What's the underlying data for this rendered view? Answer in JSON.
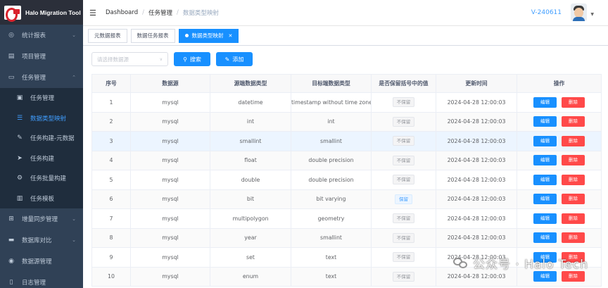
{
  "app": {
    "title": "Halo Migration Tool"
  },
  "sidebar": {
    "items": [
      {
        "label": "统计报表",
        "icon": "dashboard-icon"
      },
      {
        "label": "项目管理",
        "icon": "database-icon"
      },
      {
        "label": "任务管理",
        "icon": "monitor-icon",
        "expanded": true
      }
    ],
    "submenu": [
      {
        "label": "任务管理",
        "icon": "clipboard-icon"
      },
      {
        "label": "数据类型映射",
        "icon": "list-icon",
        "active": true
      },
      {
        "label": "任务构建-元数据",
        "icon": "edit-icon"
      },
      {
        "label": "任务构建",
        "icon": "send-icon"
      },
      {
        "label": "任务批量构建",
        "icon": "gear-icon"
      },
      {
        "label": "任务模板",
        "icon": "server-icon"
      }
    ],
    "items2": [
      {
        "label": "增量同步管理",
        "icon": "sitemap-icon"
      },
      {
        "label": "数据库对比",
        "icon": "folder-icon"
      },
      {
        "label": "数据源管理",
        "icon": "database-icon"
      },
      {
        "label": "日志管理",
        "icon": "document-icon"
      }
    ]
  },
  "navbar": {
    "breadcrumb": [
      "Dashboard",
      "任务管理",
      "数据类型映射"
    ],
    "version": "V-240611"
  },
  "tags": [
    {
      "label": "元数据报表"
    },
    {
      "label": "数据任务报表"
    },
    {
      "label": "数据类型映射",
      "active": true
    }
  ],
  "toolbar": {
    "select_placeholder": "请选择数据源",
    "search_label": "搜索",
    "add_label": "添加"
  },
  "table": {
    "columns": [
      "序号",
      "数据源",
      "源端数据类型",
      "目标端数据类型",
      "是否保留括号中的值",
      "更新时间",
      "操作"
    ],
    "rows": [
      [
        "1",
        "mysql",
        "datetime",
        "timestamp without time zone",
        "不保留",
        "2024-04-28 12:00:03"
      ],
      [
        "2",
        "mysql",
        "int",
        "int",
        "不保留",
        "2024-04-28 12:00:03"
      ],
      [
        "3",
        "mysql",
        "smallint",
        "smallint",
        "不保留",
        "2024-04-28 12:00:03"
      ],
      [
        "4",
        "mysql",
        "float",
        "double precision",
        "不保留",
        "2024-04-28 12:00:03"
      ],
      [
        "5",
        "mysql",
        "double",
        "double precision",
        "不保留",
        "2024-04-28 12:00:03"
      ],
      [
        "6",
        "mysql",
        "bit",
        "bit varying",
        "保留",
        "2024-04-28 12:00:03"
      ],
      [
        "7",
        "mysql",
        "multipolygon",
        "geometry",
        "不保留",
        "2024-04-28 12:00:03"
      ],
      [
        "8",
        "mysql",
        "year",
        "smallint",
        "不保留",
        "2024-04-28 12:00:03"
      ],
      [
        "9",
        "mysql",
        "set",
        "text",
        "不保留",
        "2024-04-28 12:00:03"
      ],
      [
        "10",
        "mysql",
        "enum",
        "text",
        "不保留",
        "2024-04-28 12:00:03"
      ]
    ],
    "edit_label": "编辑",
    "delete_label": "删除"
  },
  "watermark": {
    "text": "公众号 · Halo Tech"
  },
  "colors": {
    "sidebar": "#304156",
    "accent": "#1890ff",
    "danger": "#ff4949"
  }
}
